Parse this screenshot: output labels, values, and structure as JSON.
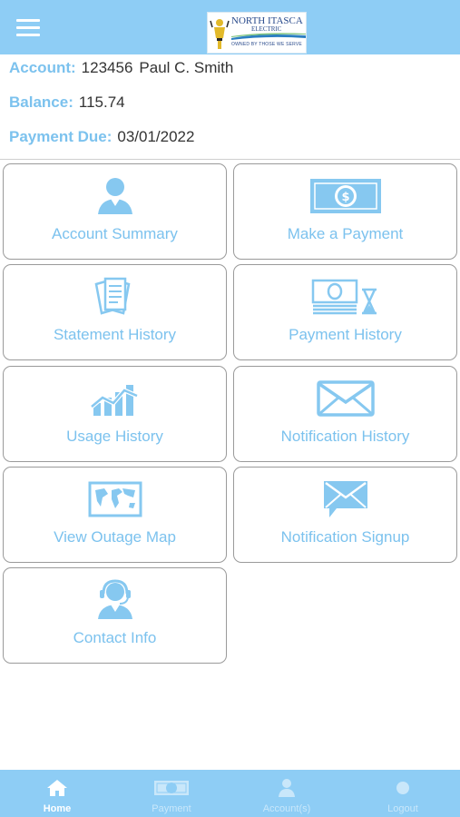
{
  "header": {
    "menu_icon": "hamburger-menu-icon",
    "logo": {
      "name": "NORTH ITASCA",
      "sub": "ELECTRIC",
      "tagline": "OWNED BY THOSE WE SERVE"
    }
  },
  "account": {
    "account_label": "Account:",
    "account_number": "123456",
    "account_name": "Paul C. Smith",
    "balance_label": "Balance:",
    "balance_value": "115.74",
    "due_label": "Payment Due:",
    "due_value": "03/01/2022"
  },
  "tiles": [
    {
      "label": "Account Summary",
      "icon": "person-icon"
    },
    {
      "label": "Make a Payment",
      "icon": "dollar-bill-icon"
    },
    {
      "label": "Statement History",
      "icon": "documents-icon"
    },
    {
      "label": "Payment History",
      "icon": "money-hourglass-icon"
    },
    {
      "label": "Usage History",
      "icon": "chart-trend-icon"
    },
    {
      "label": "Notification History",
      "icon": "envelope-icon"
    },
    {
      "label": "View Outage Map",
      "icon": "world-map-icon"
    },
    {
      "label": "Notification Signup",
      "icon": "message-envelope-icon"
    },
    {
      "label": "Contact Info",
      "icon": "support-agent-icon"
    }
  ],
  "tabbar": {
    "tabs": [
      {
        "label": "Home",
        "icon": "home-icon",
        "active": true
      },
      {
        "label": "Payment",
        "icon": "money-icon",
        "active": false
      },
      {
        "label": "Account(s)",
        "icon": "account-icon",
        "active": false
      },
      {
        "label": "Logout",
        "icon": "logout-icon",
        "active": false
      }
    ]
  },
  "colors": {
    "primary": "#8ecdf5",
    "accent_text": "#7cc2ee",
    "icon_fill": "#86c8f0",
    "text": "#333333",
    "border": "#9a9a9a"
  }
}
